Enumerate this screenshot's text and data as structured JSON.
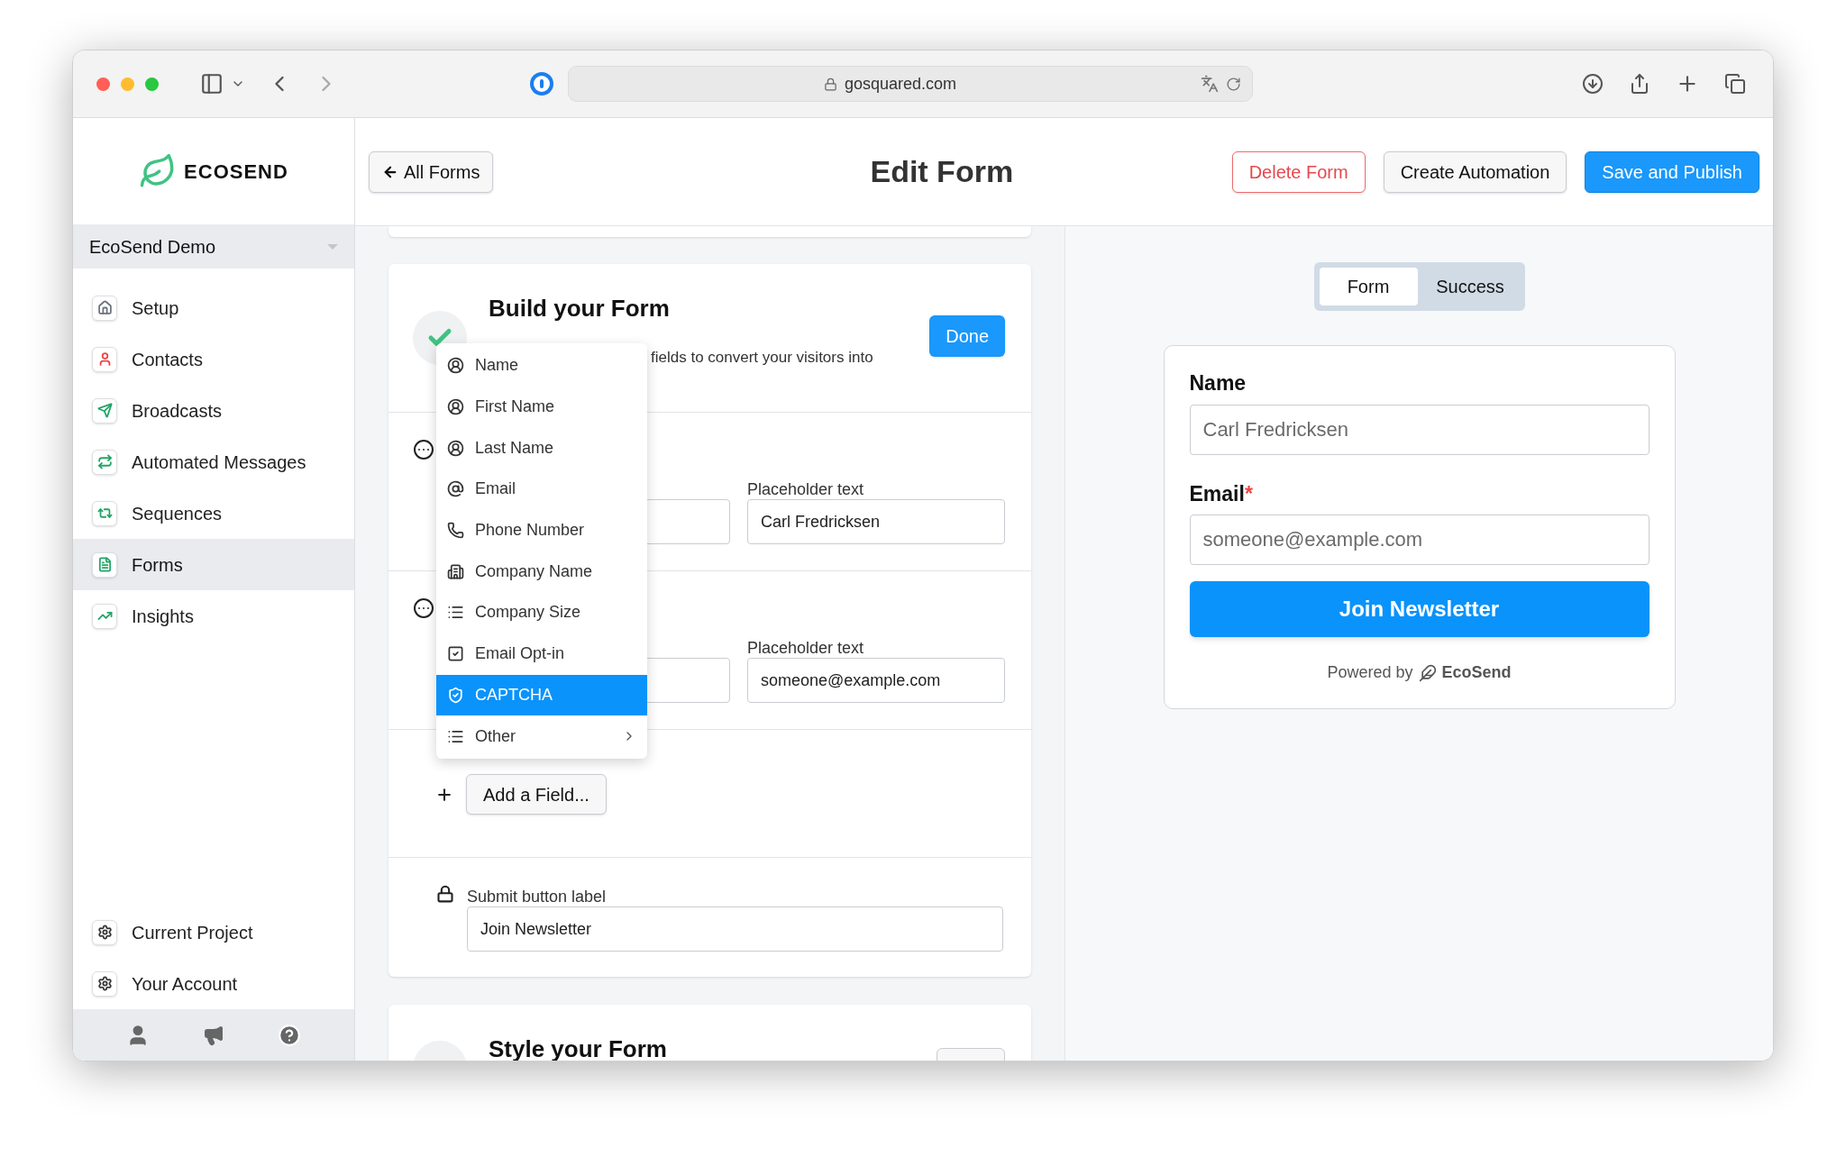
{
  "browser": {
    "url": "gosquared.com"
  },
  "sidebar": {
    "brand": "ECOSEND",
    "project": "EcoSend Demo",
    "items": [
      {
        "label": "Setup",
        "selected": false
      },
      {
        "label": "Contacts",
        "selected": false
      },
      {
        "label": "Broadcasts",
        "selected": false
      },
      {
        "label": "Automated Messages",
        "selected": false
      },
      {
        "label": "Sequences",
        "selected": false
      },
      {
        "label": "Forms",
        "selected": true
      },
      {
        "label": "Insights",
        "selected": false
      }
    ],
    "bottom_items": [
      {
        "label": "Current Project"
      },
      {
        "label": "Your Account"
      }
    ]
  },
  "header": {
    "back": "All Forms",
    "title": "Edit Form",
    "buttons": [
      {
        "label": "Delete Form",
        "kind": "danger"
      },
      {
        "label": "Create Automation",
        "kind": "default"
      },
      {
        "label": "Save and Publish",
        "kind": "primary"
      }
    ]
  },
  "build_card": {
    "title": "Build your Form",
    "description": "fields to convert your visitors into",
    "done": "Done",
    "fields": [
      {
        "placeholder_label": "Placeholder text",
        "value": "Carl Fredricksen"
      },
      {
        "placeholder_label": "Placeholder text",
        "value": "someone@example.com"
      }
    ],
    "add_field": "Add a Field...",
    "submit": {
      "label": "Submit button label",
      "value": "Join Newsletter"
    }
  },
  "field_menu": {
    "items": [
      {
        "label": "Name",
        "selected": false
      },
      {
        "label": "First Name",
        "selected": false
      },
      {
        "label": "Last Name",
        "selected": false
      },
      {
        "label": "Email",
        "selected": false
      },
      {
        "label": "Phone Number",
        "selected": false
      },
      {
        "label": "Company Name",
        "selected": false
      },
      {
        "label": "Company Size",
        "selected": false
      },
      {
        "label": "Email Opt-in",
        "selected": false
      },
      {
        "label": "CAPTCHA",
        "selected": true
      },
      {
        "label": "Other",
        "selected": false,
        "submenu": true
      }
    ]
  },
  "style_card": {
    "title": "Style your Form"
  },
  "preview": {
    "tabs": [
      {
        "label": "Form",
        "selected": true
      },
      {
        "label": "Success",
        "selected": false
      }
    ],
    "fields": [
      {
        "label": "Name",
        "required": false,
        "placeholder": "Carl Fredricksen"
      },
      {
        "label": "Email",
        "required": true,
        "placeholder": "someone@example.com"
      }
    ],
    "required_mark": "*",
    "button": "Join Newsletter",
    "powered_by": "Powered by",
    "brand": "EcoSend"
  }
}
